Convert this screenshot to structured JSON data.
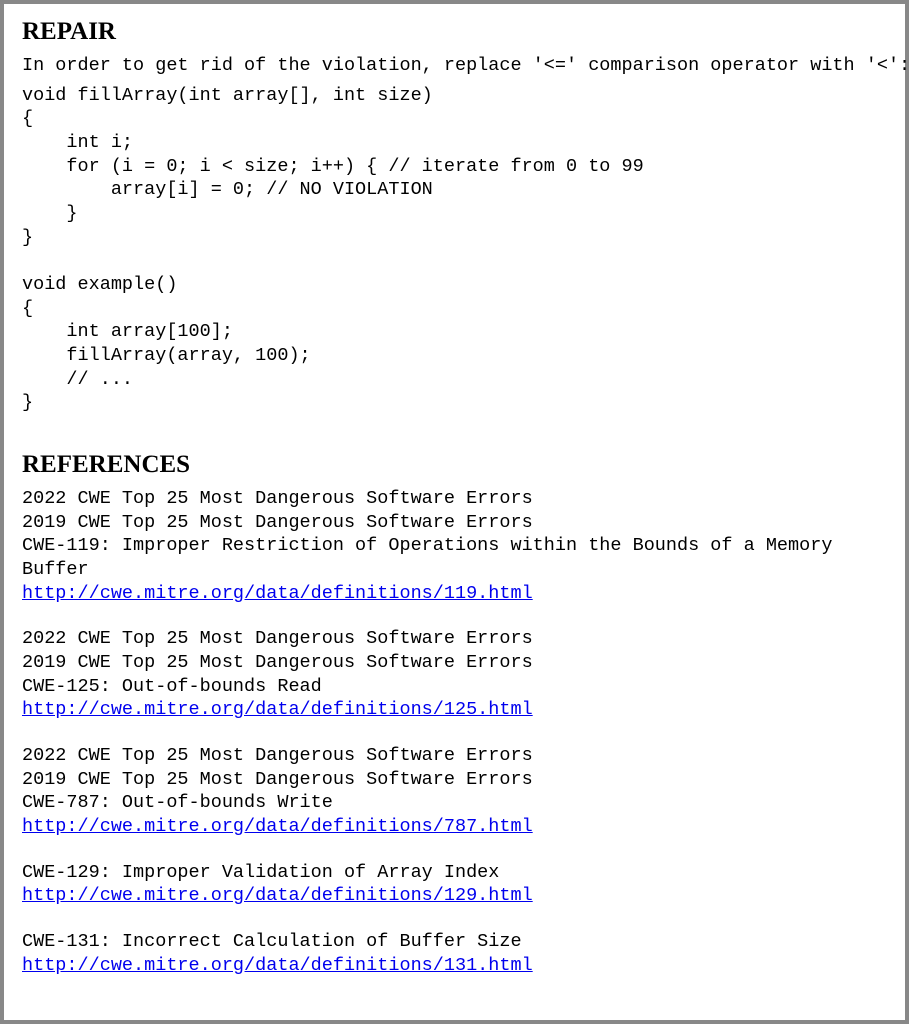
{
  "repair": {
    "heading": "REPAIR",
    "intro": "In order to get rid of the violation, replace '<=' comparison operator with '<':",
    "code": "void fillArray(int array[], int size)\n{\n    int i;\n    for (i = 0; i < size; i++) { // iterate from 0 to 99\n        array[i] = 0; // NO VIOLATION\n    }\n}\n\nvoid example()\n{\n    int array[100];\n    fillArray(array, 100);\n    // ...\n}"
  },
  "references": {
    "heading": "REFERENCES",
    "groups": [
      {
        "lines": [
          "2022 CWE Top 25 Most Dangerous Software Errors",
          "2019 CWE Top 25 Most Dangerous Software Errors",
          "CWE-119: Improper Restriction of Operations within the Bounds of a Memory Buffer"
        ],
        "link": "http://cwe.mitre.org/data/definitions/119.html"
      },
      {
        "lines": [
          "2022 CWE Top 25 Most Dangerous Software Errors",
          "2019 CWE Top 25 Most Dangerous Software Errors",
          "CWE-125: Out-of-bounds Read"
        ],
        "link": "http://cwe.mitre.org/data/definitions/125.html"
      },
      {
        "lines": [
          "2022 CWE Top 25 Most Dangerous Software Errors",
          "2019 CWE Top 25 Most Dangerous Software Errors",
          "CWE-787: Out-of-bounds Write"
        ],
        "link": "http://cwe.mitre.org/data/definitions/787.html"
      },
      {
        "lines": [
          "CWE-129: Improper Validation of Array Index"
        ],
        "link": "http://cwe.mitre.org/data/definitions/129.html"
      },
      {
        "lines": [
          "CWE-131: Incorrect Calculation of Buffer Size"
        ],
        "link": "http://cwe.mitre.org/data/definitions/131.html"
      }
    ]
  }
}
